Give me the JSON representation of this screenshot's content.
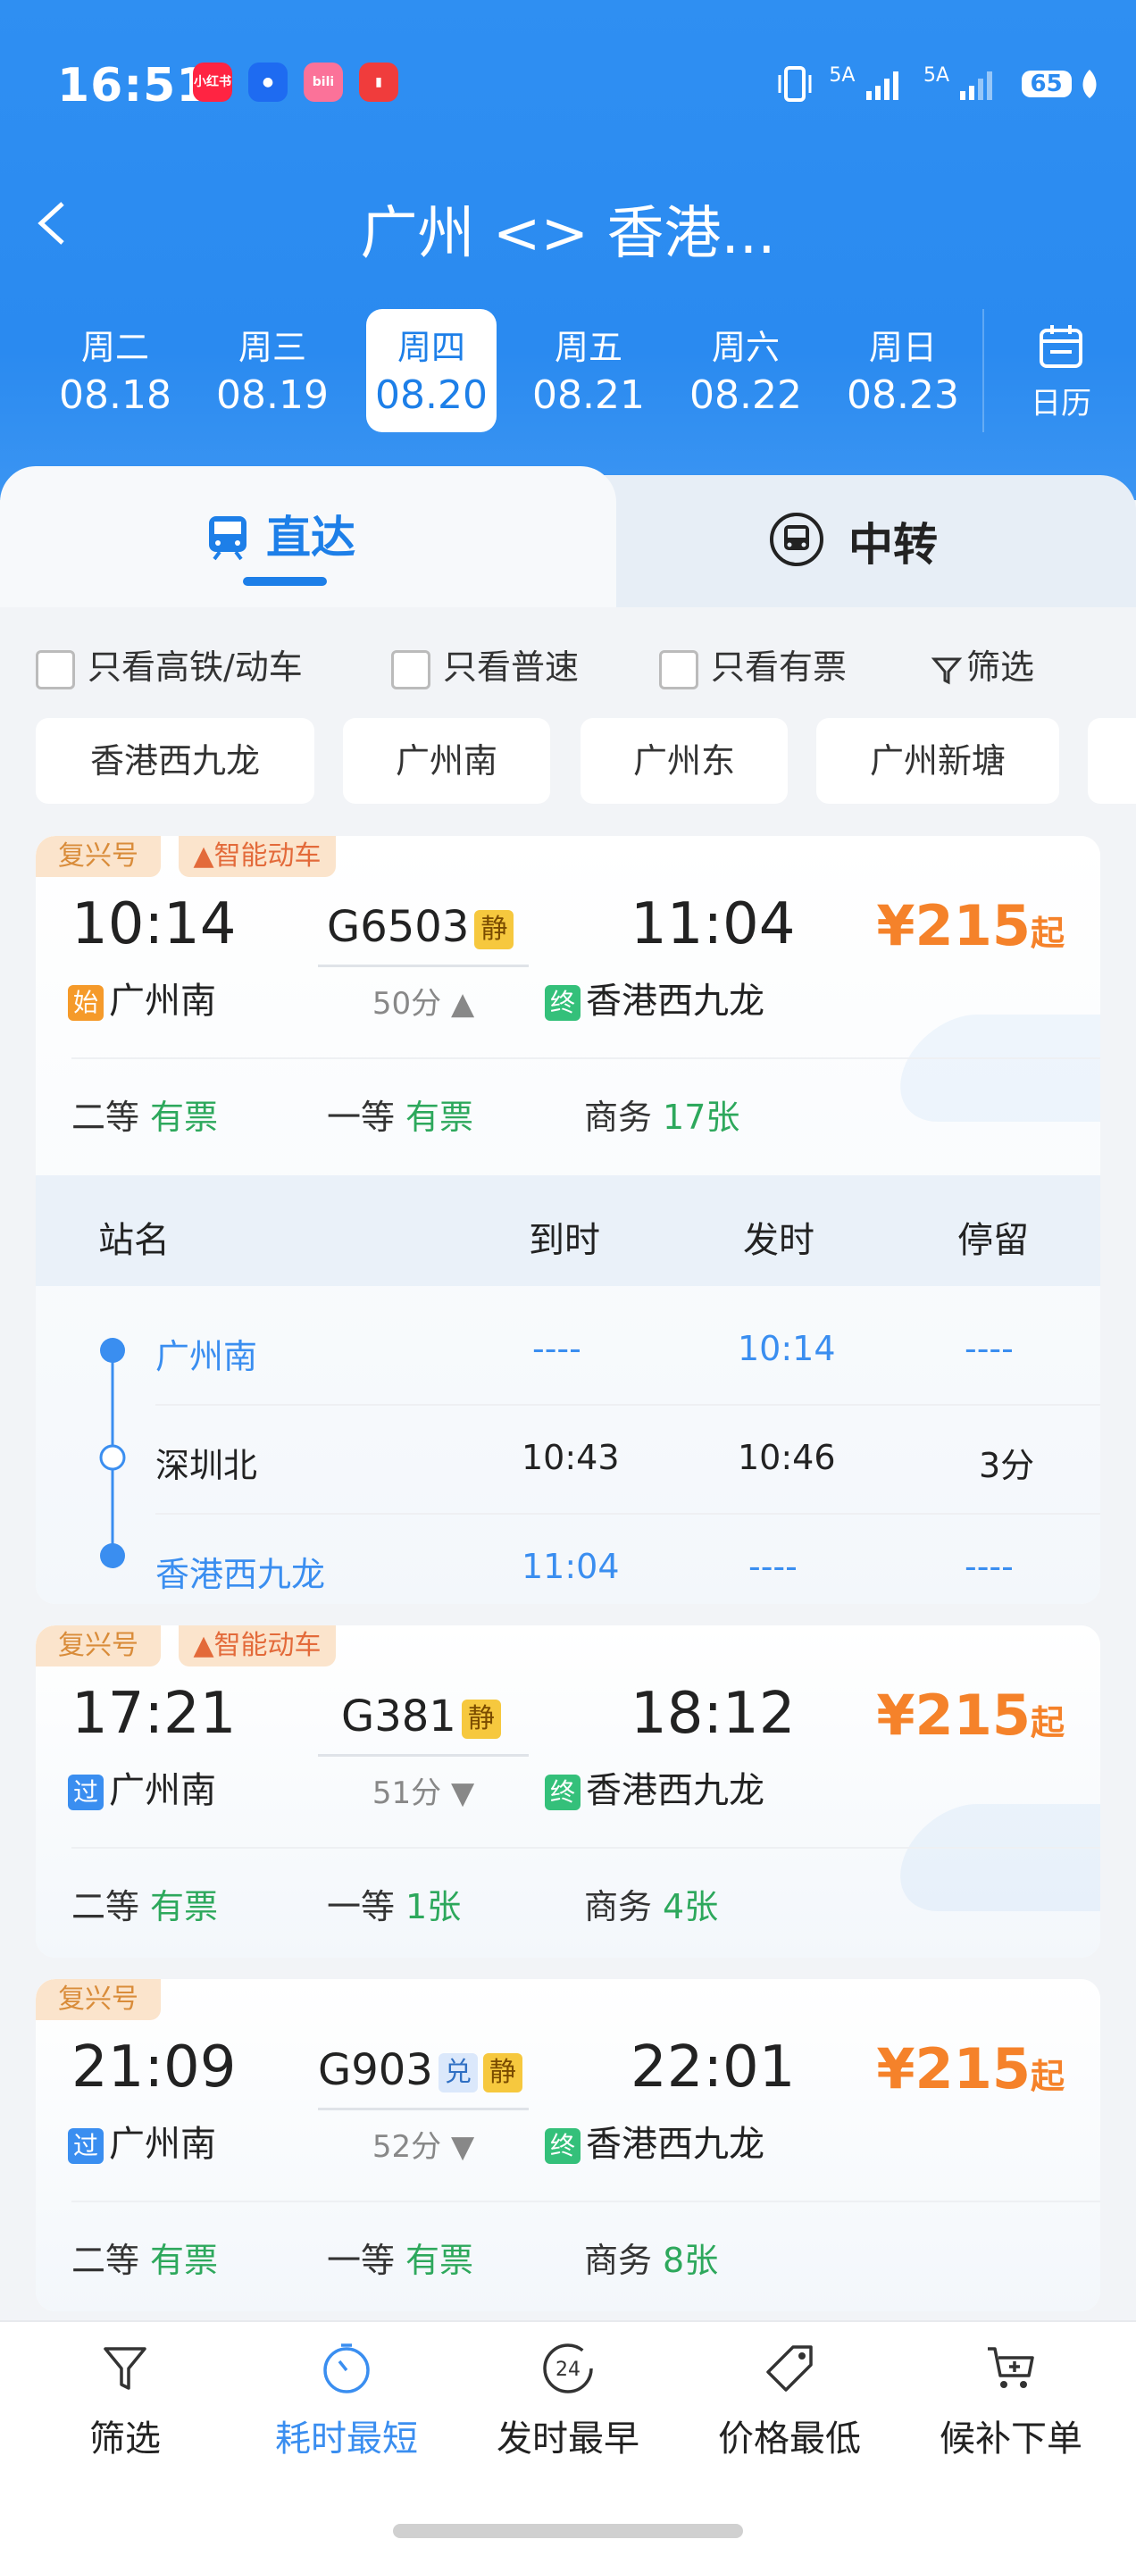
{
  "status_bar": {
    "time": "16:51",
    "net1": "5A",
    "net2": "5A",
    "battery": "65"
  },
  "header": {
    "title": "广州 <> 香港..."
  },
  "dates": [
    {
      "weekday": "周二",
      "date": "08.18"
    },
    {
      "weekday": "周三",
      "date": "08.19"
    },
    {
      "weekday": "周四",
      "date": "08.20",
      "active": true
    },
    {
      "weekday": "周五",
      "date": "08.21"
    },
    {
      "weekday": "周六",
      "date": "08.22"
    },
    {
      "weekday": "周日",
      "date": "08.23"
    }
  ],
  "calendar_label": "日历",
  "tabs": {
    "direct": "直达",
    "transfer": "中转"
  },
  "filters": {
    "high_speed": "只看高铁/动车",
    "normal": "只看普速",
    "available": "只看有票",
    "filter": "筛选"
  },
  "chips": [
    "香港西九龙",
    "广州南",
    "广州东",
    "广州新塘"
  ],
  "trains": [
    {
      "tags": [
        "复兴号",
        "智能动车"
      ],
      "dep_time": "10:14",
      "arr_time": "11:04",
      "number": "G6503",
      "badges": [
        "静"
      ],
      "duration": "50分",
      "from_mark": "始",
      "from": "广州南",
      "to_mark": "终",
      "to": "香港西九龙",
      "price": "¥215",
      "price_suffix": "起",
      "seats": [
        {
          "cls": "二等",
          "val": "有票"
        },
        {
          "cls": "一等",
          "val": "有票"
        },
        {
          "cls": "商务",
          "val": "17张"
        }
      ],
      "stops_header": {
        "name": "站名",
        "arr": "到时",
        "dep": "发时",
        "stay": "停留"
      },
      "stops": [
        {
          "name": "广州南",
          "arr": "----",
          "dep": "10:14",
          "stay": "----",
          "highlight": true
        },
        {
          "name": "深圳北",
          "arr": "10:43",
          "dep": "10:46",
          "stay": "3分",
          "highlight": false
        },
        {
          "name": "香港西九龙",
          "arr": "11:04",
          "dep": "----",
          "stay": "----",
          "highlight": true
        }
      ]
    },
    {
      "tags": [
        "复兴号",
        "智能动车"
      ],
      "dep_time": "17:21",
      "arr_time": "18:12",
      "number": "G381",
      "badges": [
        "静"
      ],
      "duration": "51分",
      "from_mark": "过",
      "from": "广州南",
      "to_mark": "终",
      "to": "香港西九龙",
      "price": "¥215",
      "price_suffix": "起",
      "seats": [
        {
          "cls": "二等",
          "val": "有票"
        },
        {
          "cls": "一等",
          "val": "1张"
        },
        {
          "cls": "商务",
          "val": "4张"
        }
      ]
    },
    {
      "tags": [
        "复兴号"
      ],
      "dep_time": "21:09",
      "arr_time": "22:01",
      "number": "G903",
      "badges": [
        "兑",
        "静"
      ],
      "duration": "52分",
      "from_mark": "过",
      "from": "广州南",
      "to_mark": "终",
      "to": "香港西九龙",
      "price": "¥215",
      "price_suffix": "起",
      "seats": [
        {
          "cls": "二等",
          "val": "有票"
        },
        {
          "cls": "一等",
          "val": "有票"
        },
        {
          "cls": "商务",
          "val": "8张"
        }
      ]
    }
  ],
  "bottom_bar": [
    {
      "label": "筛选",
      "icon": "filter-icon"
    },
    {
      "label": "耗时最短",
      "icon": "timer-icon",
      "active": true
    },
    {
      "label": "发时最早",
      "icon": "clock-24-icon"
    },
    {
      "label": "价格最低",
      "icon": "price-tag-icon"
    },
    {
      "label": "候补下单",
      "icon": "cart-add-icon"
    }
  ],
  "colors": {
    "primary": "#2a8af0",
    "price": "#f5822a",
    "available": "#2da85c"
  }
}
